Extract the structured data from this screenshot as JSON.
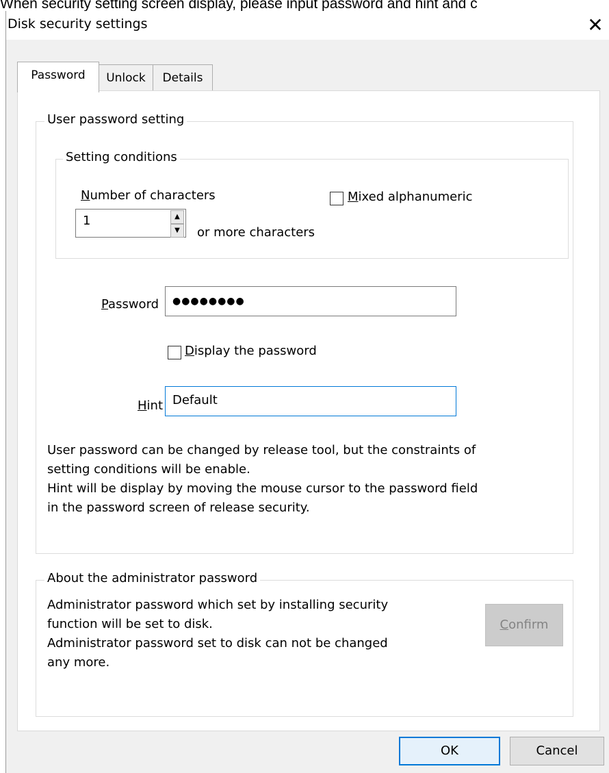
{
  "caption": "When security setting screen display, please input password and hint and c",
  "window": {
    "title": "Disk security settings",
    "close_glyph": "✕"
  },
  "tabs": [
    {
      "label": "Password",
      "active": true
    },
    {
      "label": "Unlock",
      "active": false
    },
    {
      "label": "Details",
      "active": false
    }
  ],
  "user_password_group": {
    "legend": "User password setting",
    "setting_conditions": {
      "legend": "Setting conditions",
      "num_chars_label_mnemonic": "N",
      "num_chars_label_rest": "umber of characters",
      "num_chars_value": "1",
      "or_more_label": "or more characters",
      "mixed_alnum_mnemonic": "M",
      "mixed_alnum_rest": "ixed alphanumeric",
      "mixed_alnum_checked": false
    },
    "password_label_mnemonic": "P",
    "password_label_rest": "assword",
    "password_value": "●●●●●●●●",
    "display_password_mnemonic": "D",
    "display_password_rest": "isplay the password",
    "display_password_checked": false,
    "hint_label_mnemonic": "H",
    "hint_label_rest": "int",
    "hint_value": "Default",
    "info_lines": [
      "User password can be changed by release tool, but the constraints of",
      "setting conditions will be enable.",
      "Hint will be display by moving the mouse cursor to the password field",
      "in the password screen of release security."
    ]
  },
  "admin_group": {
    "legend": "About the administrator password",
    "lines": [
      "Administrator password which set by installing security",
      "function will be set to disk.",
      "Administrator password set to disk can not be changed",
      "any more."
    ],
    "confirm_mnemonic": "C",
    "confirm_rest": "onfirm",
    "confirm_enabled": false
  },
  "footer": {
    "ok_label": "OK",
    "cancel_label": "Cancel"
  },
  "colors": {
    "accent": "#0078d7",
    "ok_bg": "#e5f1fb",
    "disabled_bg": "#cccccc",
    "disabled_text": "#838383"
  }
}
